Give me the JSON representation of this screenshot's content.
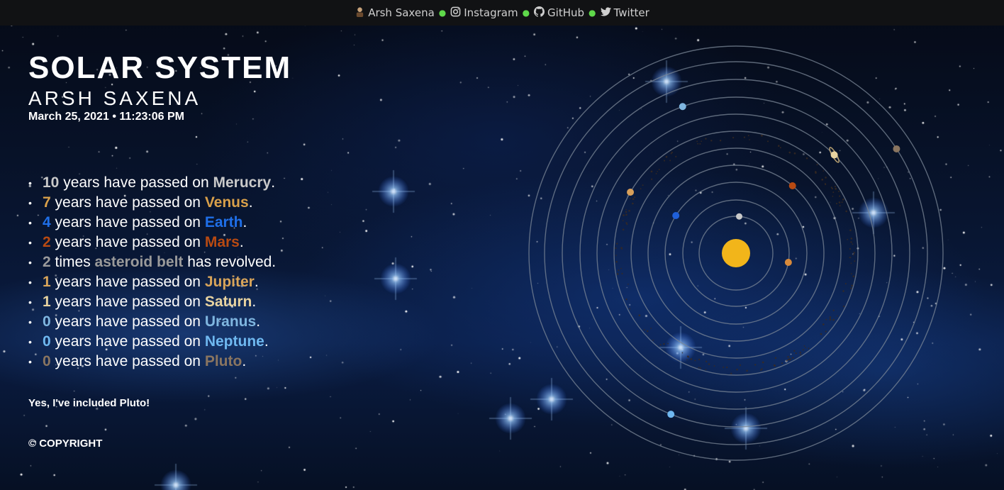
{
  "topbar": {
    "author": "Arsh Saxena",
    "instagram": "Instagram",
    "github": "GitHub",
    "twitter": "Twitter",
    "dot_color": "#5fd84a"
  },
  "header": {
    "title": "SOLAR SYSTEM",
    "subtitle": "ARSH SAXENA",
    "date": "March 25, 2021",
    "separator": "•",
    "time": "11:23:06 PM"
  },
  "years": [
    {
      "count": "10",
      "pre": " years have passed on ",
      "name": "Merucry",
      "post": ".",
      "color": "#c9c9c9"
    },
    {
      "count": "7",
      "pre": " years have passed on ",
      "name": "Venus",
      "post": ".",
      "color": "#d9a04a"
    },
    {
      "count": "4",
      "pre": " years have passed on ",
      "name": "Earth",
      "post": ".",
      "color": "#1f6fe8"
    },
    {
      "count": "2",
      "pre": " years have passed on ",
      "name": "Mars",
      "post": ".",
      "color": "#b84a12"
    },
    {
      "count": "2",
      "pre": " times ",
      "name": "asteroid belt",
      "post": " has revolved.",
      "color": "#9a9a9a"
    },
    {
      "count": "1",
      "pre": " years have passed on ",
      "name": "Jupiter",
      "post": ".",
      "color": "#d9a55a"
    },
    {
      "count": "1",
      "pre": " years have passed on ",
      "name": "Saturn",
      "post": ".",
      "color": "#e8d3a0"
    },
    {
      "count": "0",
      "pre": " years have passed on ",
      "name": "Uranus",
      "post": ".",
      "color": "#7fb6e0"
    },
    {
      "count": "0",
      "pre": " years have passed on ",
      "name": "Neptune",
      "post": ".",
      "color": "#6fb8f0"
    },
    {
      "count": "0",
      "pre": " years have passed on ",
      "name": "Pluto",
      "post": ".",
      "color": "#8a7560"
    }
  ],
  "note": "Yes, I've included Pluto!",
  "copyright": "© COPYRIGHT",
  "colors": {
    "sun": "#f2b51a",
    "orbit": "#7a8696",
    "topbar_bg": "#111214"
  }
}
